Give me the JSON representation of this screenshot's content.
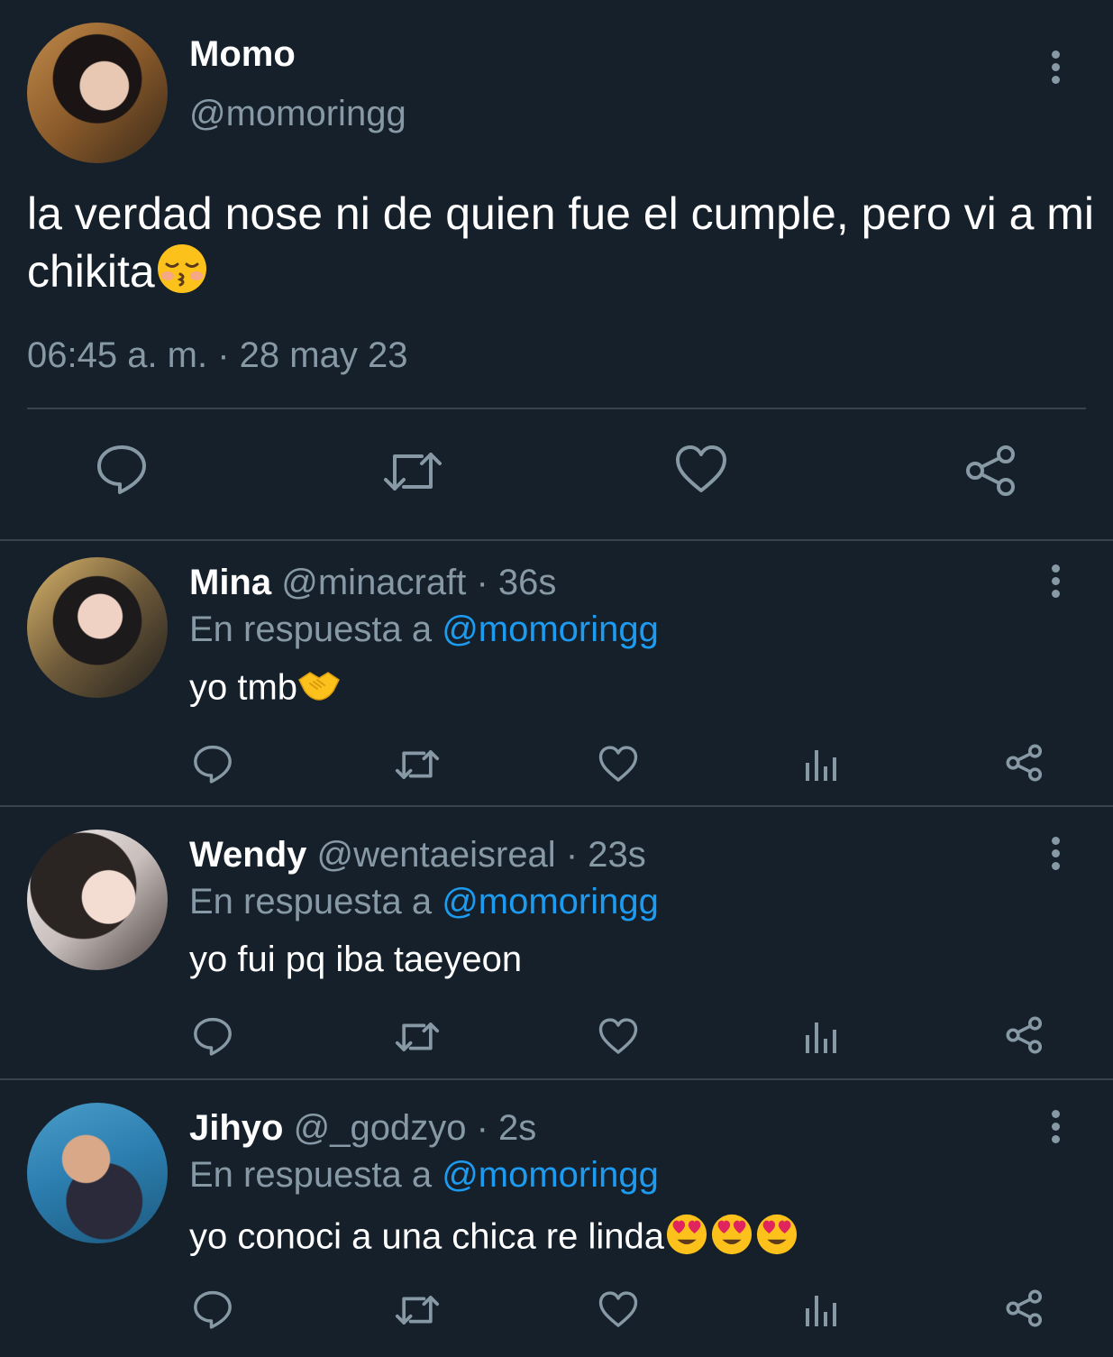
{
  "main_tweet": {
    "name": "Momo",
    "handle": "@momoringg",
    "text": "la verdad nose ni de quien fue el cumple, pero vi a mi chikita",
    "emoji": "kissing-face-closed-eyes",
    "time": "06:45 a. m.",
    "separator": " · ",
    "date": "28 may 23"
  },
  "replies": [
    {
      "name": "Mina",
      "handle": "@minacraft",
      "separator": " · ",
      "time": "36s",
      "reply_prefix": "En respuesta a ",
      "reply_to": "@momoringg",
      "text": "yo tmb",
      "emojis": [
        "handshake"
      ]
    },
    {
      "name": "Wendy",
      "handle": "@wentaeisreal",
      "separator": " · ",
      "time": "23s",
      "reply_prefix": "En respuesta a ",
      "reply_to": "@momoringg",
      "text": "yo fui pq iba taeyeon",
      "emojis": []
    },
    {
      "name": "Jihyo",
      "handle": "@_godzyo",
      "separator": " · ",
      "time": "2s",
      "reply_prefix": "En respuesta a ",
      "reply_to": "@momoringg",
      "text": "yo conoci a una chica re linda",
      "emojis": [
        "heart-eyes",
        "heart-eyes",
        "heart-eyes"
      ]
    }
  ],
  "colors": {
    "background": "#15202b",
    "text": "#ffffff",
    "secondary": "#8899a6",
    "link": "#1d9bf0",
    "divider": "#38444d"
  }
}
